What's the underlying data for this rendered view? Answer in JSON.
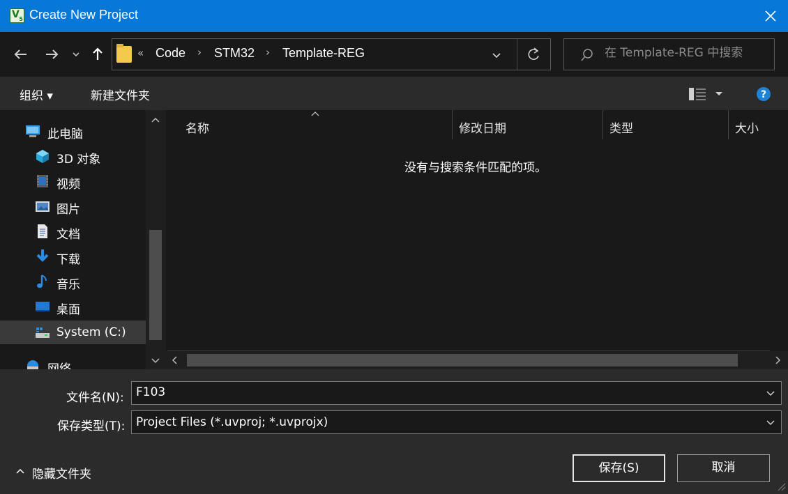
{
  "window": {
    "title": "Create New Project",
    "icon": "keil-uvision-icon"
  },
  "address": {
    "overflow": "«",
    "crumbs": [
      "Code",
      "STM32",
      "Template-REG"
    ],
    "search_placeholder": "在 Template-REG 中搜索"
  },
  "toolbar": {
    "organize_label": "组织 ▾",
    "new_folder_label": "新建文件夹"
  },
  "nav": {
    "items": [
      {
        "label": "此电脑",
        "icon": "computer-icon"
      },
      {
        "label": "3D 对象",
        "icon": "3d-objects-icon"
      },
      {
        "label": "视频",
        "icon": "video-icon"
      },
      {
        "label": "图片",
        "icon": "pictures-icon"
      },
      {
        "label": "文档",
        "icon": "documents-icon"
      },
      {
        "label": "下载",
        "icon": "download-icon"
      },
      {
        "label": "音乐",
        "icon": "music-icon"
      },
      {
        "label": "桌面",
        "icon": "desktop-icon"
      },
      {
        "label": "System (C:)",
        "icon": "drive-icon"
      },
      {
        "label": "网络",
        "icon": "network-icon"
      }
    ],
    "selected_index": 8
  },
  "files": {
    "columns": [
      "名称",
      "修改日期",
      "类型",
      "大小"
    ],
    "empty_message": "没有与搜索条件匹配的项。"
  },
  "form": {
    "filename_label": "文件名(N):",
    "filename_value": "F103",
    "filetype_label": "保存类型(T):",
    "filetype_value": "Project Files (*.uvproj; *.uvprojx)"
  },
  "footer": {
    "hide_folders_label": "隐藏文件夹",
    "save_label": "保存(S)",
    "cancel_label": "取消"
  },
  "colors": {
    "titlebar": "#0778d8",
    "background": "#191919",
    "panel": "#2b2b2b",
    "help": "#1e82d6"
  }
}
